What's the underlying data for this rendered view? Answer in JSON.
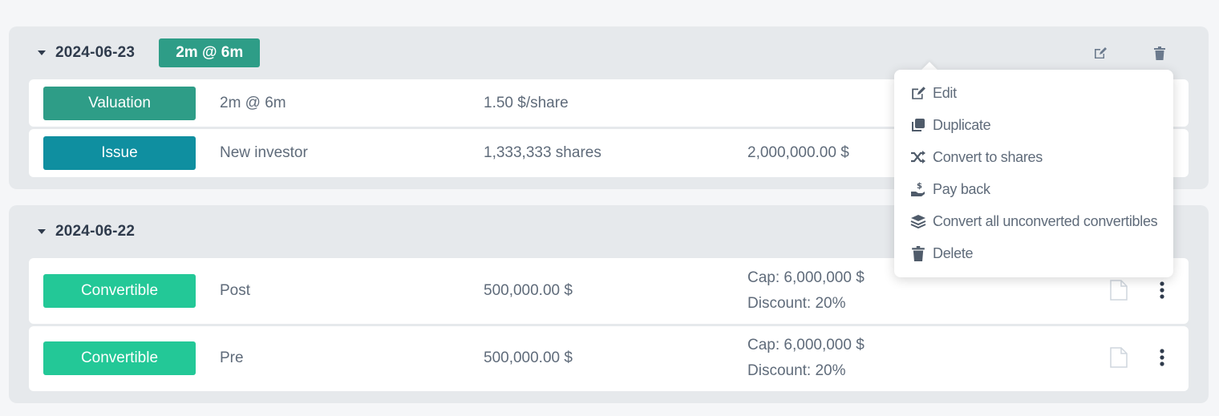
{
  "groups": [
    {
      "date": "2024-06-23",
      "badge": "2m @ 6m",
      "header_icons": [
        "edit-icon",
        "trash-icon"
      ],
      "rows": [
        {
          "type": "Valuation",
          "col2": "2m @ 6m",
          "col3": "1.50 $/share",
          "col4": []
        },
        {
          "type": "Issue",
          "col2": "New investor",
          "col3": "1,333,333 shares",
          "col4": [
            "2,000,000.00 $"
          ]
        }
      ]
    },
    {
      "date": "2024-06-22",
      "rows": [
        {
          "type": "Convertible",
          "col2": "Post",
          "col3": "500,000.00 $",
          "col4": [
            "Cap: 6,000,000 $",
            "Discount: 20%"
          ],
          "icons": [
            "document-icon",
            "kebab-menu-icon"
          ]
        },
        {
          "type": "Convertible",
          "col2": "Pre",
          "col3": "500,000.00 $",
          "col4": [
            "Cap: 6,000,000 $",
            "Discount: 20%"
          ],
          "icons": [
            "document-icon",
            "kebab-menu-icon"
          ]
        }
      ]
    }
  ],
  "dropdown_menu": {
    "items": [
      {
        "label": "Edit",
        "icon": "edit-icon"
      },
      {
        "label": "Duplicate",
        "icon": "copy-icon"
      },
      {
        "label": "Convert to shares",
        "icon": "shuffle-icon"
      },
      {
        "label": "Pay back",
        "icon": "hand-dollar-icon"
      },
      {
        "label": "Convert all unconverted convertibles",
        "icon": "layers-icon"
      },
      {
        "label": "Delete",
        "icon": "trash-icon"
      }
    ]
  },
  "colors": {
    "valuation": "#2e9d87",
    "issue": "#0f8fa0",
    "convertible": "#23c897",
    "group_bg": "#e6e9ec",
    "text": "#5f6b7a",
    "heading": "#2f3b4c"
  }
}
